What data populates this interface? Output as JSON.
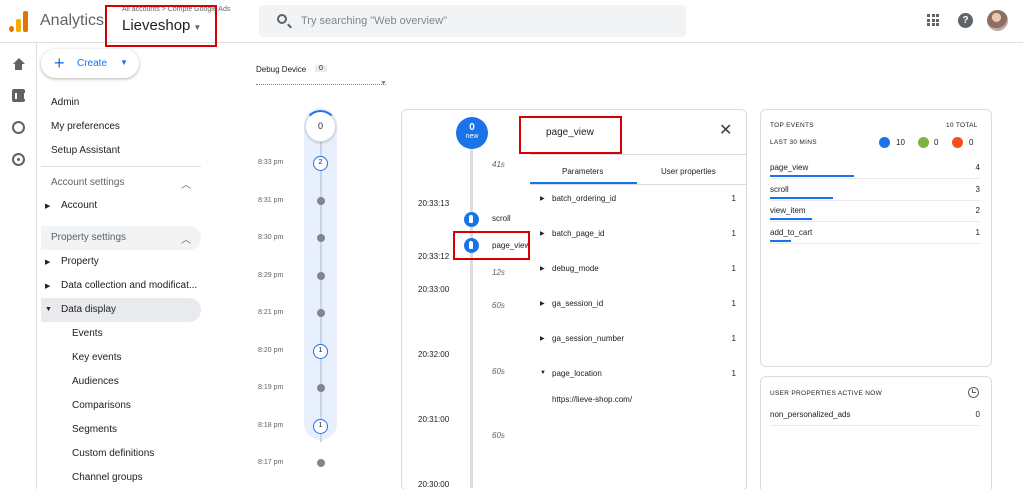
{
  "header": {
    "app_name": "Analytics",
    "breadcrumb": "All accounts > Compte Google Ads",
    "property_name": "Lieveshop",
    "search_placeholder": "Try searching \"Web overview\""
  },
  "nav": {
    "create_label": "Create",
    "items": {
      "admin": "Admin",
      "preferences": "My preferences",
      "setup": "Setup Assistant",
      "account_settings": "Account settings",
      "account": "Account",
      "property_settings": "Property settings",
      "property": "Property",
      "data_collection": "Data collection and modificat...",
      "data_display": "Data display",
      "events": "Events",
      "key_events": "Key events",
      "audiences": "Audiences",
      "comparisons": "Comparisons",
      "segments": "Segments",
      "custom_definitions": "Custom definitions",
      "channel_groups": "Channel groups"
    }
  },
  "debug": {
    "device_label": "Debug Device",
    "device_count": "0",
    "top_count": "0",
    "minutes": [
      {
        "time": "8:33 pm",
        "count": "2"
      },
      {
        "time": "8:31 pm",
        "count": ""
      },
      {
        "time": "8:30 pm",
        "count": ""
      },
      {
        "time": "8:29 pm",
        "count": ""
      },
      {
        "time": "8:21 pm",
        "count": ""
      },
      {
        "time": "8:20 pm",
        "count": "1"
      },
      {
        "time": "8:19 pm",
        "count": ""
      },
      {
        "time": "8:18 pm",
        "count": "1"
      },
      {
        "time": "8:17 pm",
        "count": ""
      }
    ]
  },
  "stream": {
    "new_count": "0",
    "new_label": "new",
    "gaps": [
      "41s",
      "12s",
      "60s",
      "60s",
      "60s"
    ],
    "timestamps": [
      "20:33:13",
      "20:33:12",
      "20:33:00",
      "20:32:00",
      "20:31:00",
      "20:30:00"
    ],
    "events": [
      "scroll",
      "page_view"
    ]
  },
  "detail": {
    "title": "page_view",
    "tab_parameters": "Parameters",
    "tab_user_properties": "User properties",
    "params": [
      {
        "name": "batch_ordering_id",
        "value": "1",
        "expanded": false
      },
      {
        "name": "batch_page_id",
        "value": "1",
        "expanded": false
      },
      {
        "name": "debug_mode",
        "value": "1",
        "expanded": false
      },
      {
        "name": "ga_session_id",
        "value": "1",
        "expanded": false
      },
      {
        "name": "ga_session_number",
        "value": "1",
        "expanded": false
      },
      {
        "name": "page_location",
        "value": "1",
        "expanded": true
      }
    ],
    "page_location_value": "https://lieve-shop.com/"
  },
  "top_events": {
    "title": "TOP EVENTS",
    "total": "10 TOTAL",
    "subtitle": "LAST 30 MINS",
    "legend": [
      {
        "count": "10",
        "color": "#1a73e8"
      },
      {
        "count": "0",
        "color": "#7cb342"
      },
      {
        "count": "0",
        "color": "#f4511e"
      }
    ],
    "rows": [
      {
        "name": "page_view",
        "value": "4",
        "fraction": 0.4
      },
      {
        "name": "scroll",
        "value": "3",
        "fraction": 0.3
      },
      {
        "name": "view_item",
        "value": "2",
        "fraction": 0.2
      },
      {
        "name": "add_to_cart",
        "value": "1",
        "fraction": 0.1
      }
    ]
  },
  "user_props": {
    "title": "USER PROPERTIES ACTIVE NOW",
    "rows": [
      {
        "name": "non_personalized_ads",
        "value": "0"
      }
    ]
  },
  "colors": {
    "accent": "#1a73e8",
    "highlight": "#d50000"
  }
}
